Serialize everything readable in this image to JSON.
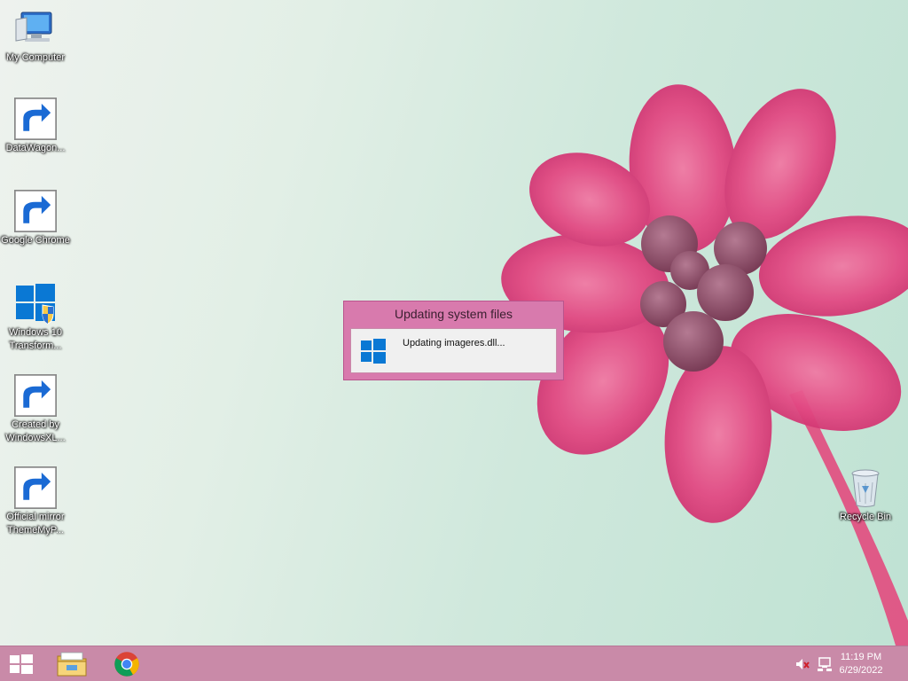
{
  "desktop": {
    "icons": [
      {
        "label": "My Computer",
        "icon": "computer-icon"
      },
      {
        "label": "DataWagon...",
        "icon": "star-shortcut-icon"
      },
      {
        "label": "Google Chrome",
        "icon": "chrome-icon"
      },
      {
        "label": "Windows 10 Transform...",
        "icon": "windows-shield-icon"
      },
      {
        "label": "Created by WindowsXL...",
        "icon": "chrome-icon"
      },
      {
        "label": "Official mirror ThemeMyP...",
        "icon": "chrome-icon"
      }
    ],
    "recycle_bin": {
      "label": "Recycle Bin",
      "icon": "recycle-bin-icon"
    }
  },
  "dialog": {
    "title": "Updating system files",
    "message": "Updating imageres.dll..."
  },
  "taskbar": {
    "pinned": [
      "start-icon",
      "file-explorer-icon",
      "chrome-icon"
    ],
    "tray": [
      "volume-muted-icon",
      "network-icon"
    ],
    "time": "11:19 PM",
    "date": "6/29/2022"
  },
  "colors": {
    "taskbar": "#c98aa8",
    "dialog_frame": "#d87aad",
    "windows_blue": "#0a78d4",
    "flower_pink": "#e0487f"
  }
}
